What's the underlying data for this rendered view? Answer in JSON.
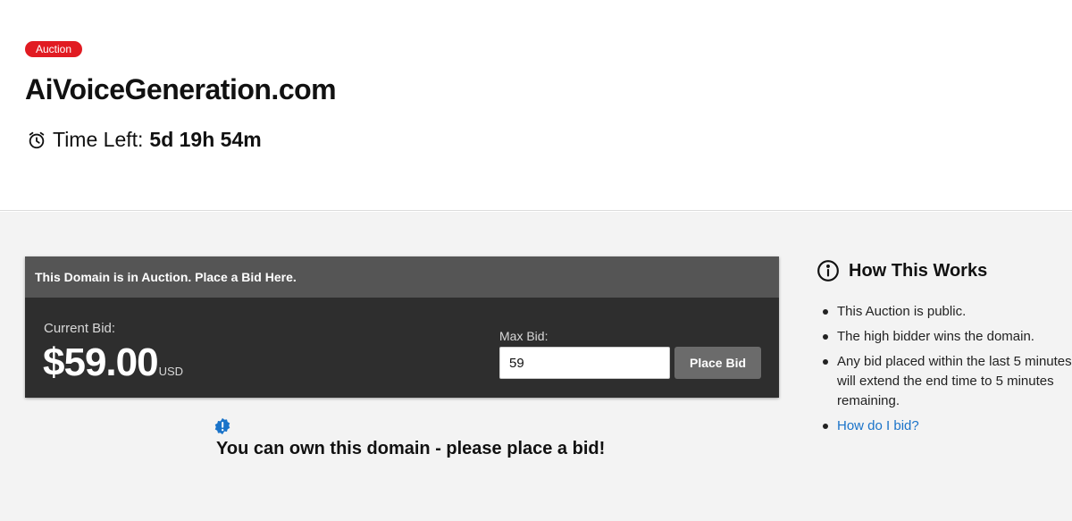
{
  "header": {
    "badge": "Auction",
    "domain": "AiVoiceGeneration.com",
    "time_left_label": "Time Left:",
    "time_left_value": "5d 19h 54m"
  },
  "auction": {
    "heading": "This Domain is in Auction. Place a Bid Here.",
    "current_bid_label": "Current Bid:",
    "current_bid_amount": "$59.00",
    "currency": "USD",
    "max_bid_label": "Max Bid:",
    "max_bid_value": "59",
    "place_bid_label": "Place Bid"
  },
  "notice": {
    "text": "You can own this domain - please place a bid!"
  },
  "how_it_works": {
    "title": "How This Works",
    "items": [
      "This Auction is public.",
      "The high bidder wins the domain.",
      "Any bid placed within the last 5 minutes",
      "will extend the end time to 5 minutes",
      "remaining."
    ],
    "link": "How do I bid?"
  },
  "colors": {
    "badge": "#e11b22",
    "auction_body": "#2e2e2e",
    "auction_header": "#555555",
    "button": "#6b6b6b",
    "link": "#1a73c9",
    "notice_icon": "#1a73c9"
  }
}
